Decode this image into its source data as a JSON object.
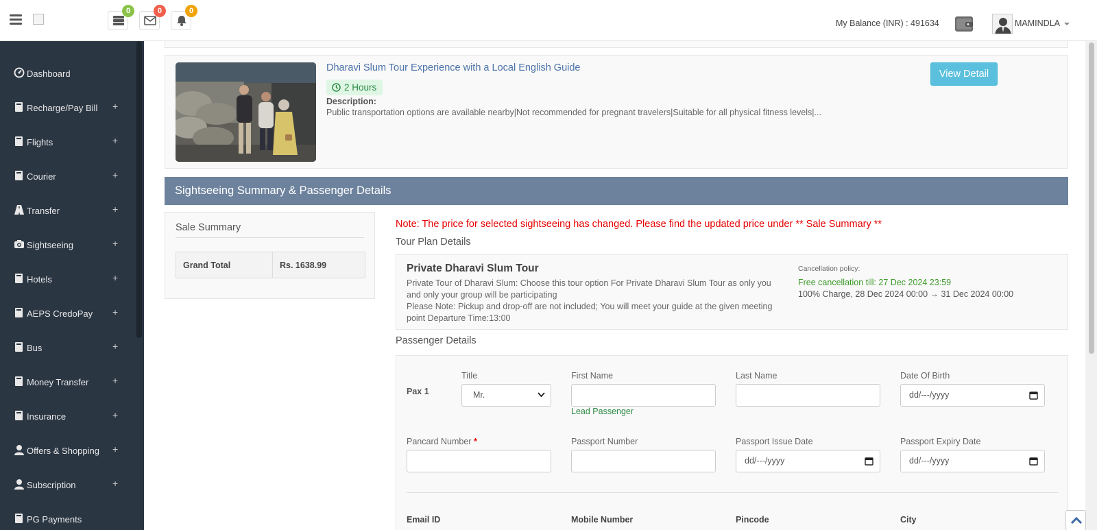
{
  "header": {
    "badges": {
      "orders": "0",
      "messages": "0",
      "notifications": "0"
    },
    "balance": "My Balance (INR) : 491634",
    "username": "MAMINDLA"
  },
  "sidebar": {
    "items": [
      {
        "label": "Dashboard",
        "icon": "dashboard-icon",
        "expandable": false
      },
      {
        "label": "Recharge/Pay Bill",
        "icon": "book-icon",
        "expandable": true
      },
      {
        "label": "Flights",
        "icon": "book-icon",
        "expandable": true
      },
      {
        "label": "Courier",
        "icon": "book-icon",
        "expandable": true
      },
      {
        "label": "Transfer",
        "icon": "road-icon",
        "expandable": true
      },
      {
        "label": "Sightseeing",
        "icon": "camera-icon",
        "expandable": true
      },
      {
        "label": "Hotels",
        "icon": "book-icon",
        "expandable": true
      },
      {
        "label": "AEPS CredoPay",
        "icon": "book-icon",
        "expandable": true
      },
      {
        "label": "Bus",
        "icon": "book-icon",
        "expandable": true
      },
      {
        "label": "Money Transfer",
        "icon": "book-icon",
        "expandable": true
      },
      {
        "label": "Insurance",
        "icon": "book-icon",
        "expandable": true
      },
      {
        "label": "Offers & Shopping",
        "icon": "user-icon",
        "expandable": true
      },
      {
        "label": "Subscription",
        "icon": "user-icon",
        "expandable": true
      },
      {
        "label": "PG Payments",
        "icon": "book-icon",
        "expandable": false
      }
    ]
  },
  "tour": {
    "title": "Dharavi Slum Tour Experience with a Local English Guide",
    "duration": "2 Hours",
    "description_label": "Description:",
    "description": "Public transportation options are available nearby|Not recommended for pregnant travelers|Suitable for all physical fitness levels|...",
    "view_button": "View Detail"
  },
  "section_title": "Sightseeing Summary & Passenger Details",
  "sale_summary": {
    "title": "Sale Summary",
    "rows": [
      {
        "label": "Grand Total",
        "value": "Rs. 1638.99"
      }
    ]
  },
  "note": "Note: The price for selected sightseeing has changed. Please find the updated price under ** Sale Summary **",
  "tour_plan": {
    "heading": "Tour Plan Details",
    "name": "Private Dharavi Slum Tour",
    "desc_line1": "Private Tour of Dharavi Slum: Choose this tour option For Private Dharavi Slum Tour as only you and only your group will be participating",
    "desc_line2": "Please Note: Pickup and drop-off are not included; You will meet your guide at the given meeting point Departure Time:13:00",
    "cancellation_label": "Cancellation policy:",
    "free_cancellation": "Free cancellation till: 27 Dec 2024 23:59",
    "charge_policy": "100% Charge, 28 Dec 2024 00:00 → 31 Dec 2024 00:00"
  },
  "passenger": {
    "heading": "Passenger Details",
    "pax_label": "Pax 1",
    "title_label": "Title",
    "title_value": "Mr.",
    "first_name_label": "First Name",
    "last_name_label": "Last Name",
    "dob_label": "Date Of Birth",
    "date_placeholder": "dd/---/yyyy",
    "lead_note": "Lead Passenger",
    "pancard_label": "Pancard Number",
    "required_mark": "*",
    "passport_label": "Passport Number",
    "passport_issue_label": "Passport Issue Date",
    "passport_expiry_label": "Passport Expiry Date",
    "email_label": "Email ID",
    "mobile_label": "Mobile Number",
    "pincode_label": "Pincode",
    "city_label": "City"
  },
  "colors": {
    "sidebar_bg": "#2b3643",
    "section_bar": "#6d829d",
    "view_button": "#5bc0de",
    "note_red": "#e60000",
    "success_green": "#2c8a45",
    "badge_green": "#8bc34a",
    "badge_red": "#f0604d",
    "badge_orange": "#f0a30a"
  }
}
